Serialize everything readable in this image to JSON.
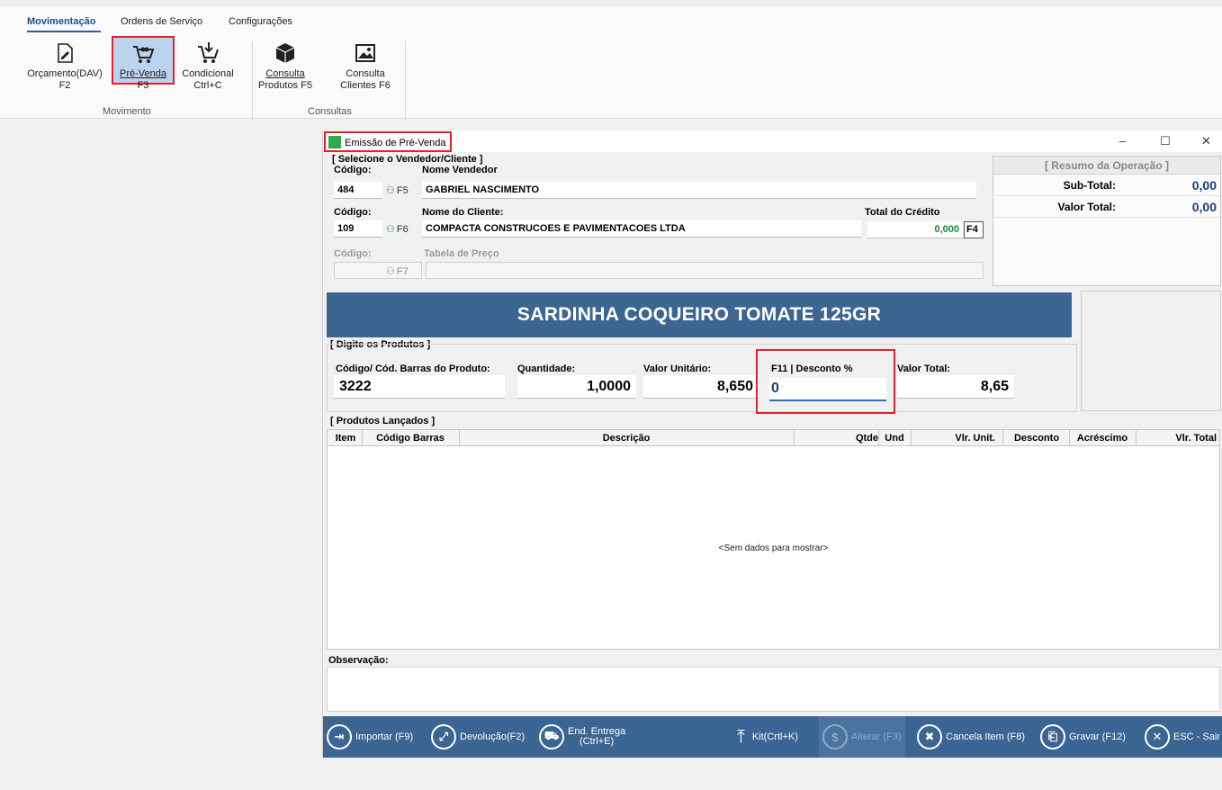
{
  "ribbon": {
    "tabs": [
      "Movimentação",
      "Ordens de Serviço",
      "Configurações"
    ],
    "buttons": [
      {
        "line1": "Orçamento(DAV)",
        "line2": "F2"
      },
      {
        "line1": "Pré-Venda",
        "line2": "F3"
      },
      {
        "line1": "Condicional",
        "line2": "Ctrl+C"
      },
      {
        "line1": "Consulta",
        "line2": "Produtos F5"
      },
      {
        "line1": "Consulta",
        "line2": "Clientes F6"
      }
    ],
    "groups": [
      "Movimento",
      "Consultas"
    ]
  },
  "window": {
    "title": "Emissão de Pré-Venda",
    "controls": {
      "minimize": "–",
      "maximize": "☐",
      "close": "✕"
    }
  },
  "vendedor": {
    "section": "[ Selecione o Vendedor/Cliente ]",
    "codigo_label": "Código:",
    "nome_label": "Nome Vendedor",
    "codigo": "484",
    "key": "F5",
    "nome": "GABRIEL NASCIMENTO"
  },
  "cliente": {
    "codigo_label": "Código:",
    "nome_label": "Nome do Cliente:",
    "codigo": "109",
    "key": "F6",
    "nome": "COMPACTA CONSTRUCOES E PAVIMENTACOES LTDA",
    "credito_label": "Total do Crédito",
    "credito": "0,000",
    "credito_key": "F4"
  },
  "tabela": {
    "codigo_label": "Código:",
    "label": "Tabela de Preço",
    "codigo": "",
    "key": "F7",
    "valor": ""
  },
  "resumo": {
    "title": "[ Resumo da Operação ]",
    "subtotal_label": "Sub-Total:",
    "subtotal": "0,00",
    "total_label": "Valor Total:",
    "total": "0,00"
  },
  "produto_atual": "SARDINHA COQUEIRO TOMATE 125GR",
  "produtos": {
    "section": "[ Digite os Produtos ]",
    "codigo_label": "Código/ Cód. Barras do Produto:",
    "codigo": "3222",
    "qtd_label": "Quantidade:",
    "qtd": "1,0000",
    "unit_label": "Valor Unitário:",
    "unit": "8,650",
    "desc_label": "F11 | Desconto %",
    "desc": "0",
    "total_label": "Valor Total:",
    "total": "8,65"
  },
  "lancados": {
    "section": "[ Produtos Lançados ]",
    "columns": [
      "Item",
      "Código Barras",
      "Descrição",
      "Qtde",
      "Und",
      "Vlr. Unit.",
      "Desconto",
      "Acréscimo",
      "Vlr. Total"
    ],
    "empty": "<Sem dados para mostrar>"
  },
  "observacao": {
    "label": "Observação:",
    "value": ""
  },
  "toolbar": {
    "importar": "Importar (F9)",
    "devolucao": "Devolução(F2)",
    "entrega1": "End. Entrega",
    "entrega2": "(Ctrl+E)",
    "kit": "Kit(Crtl+K)",
    "alterar": "Alterar (F3)",
    "cancela": "Cancela Item (F8)",
    "gravar": "Gravar (F12)",
    "sair": "ESC - Sair"
  },
  "colors": {
    "accent": "#3b6593",
    "highlight": "#e0232a",
    "value_blue": "#1d3f7a",
    "credit_green": "#1a8a2e"
  }
}
